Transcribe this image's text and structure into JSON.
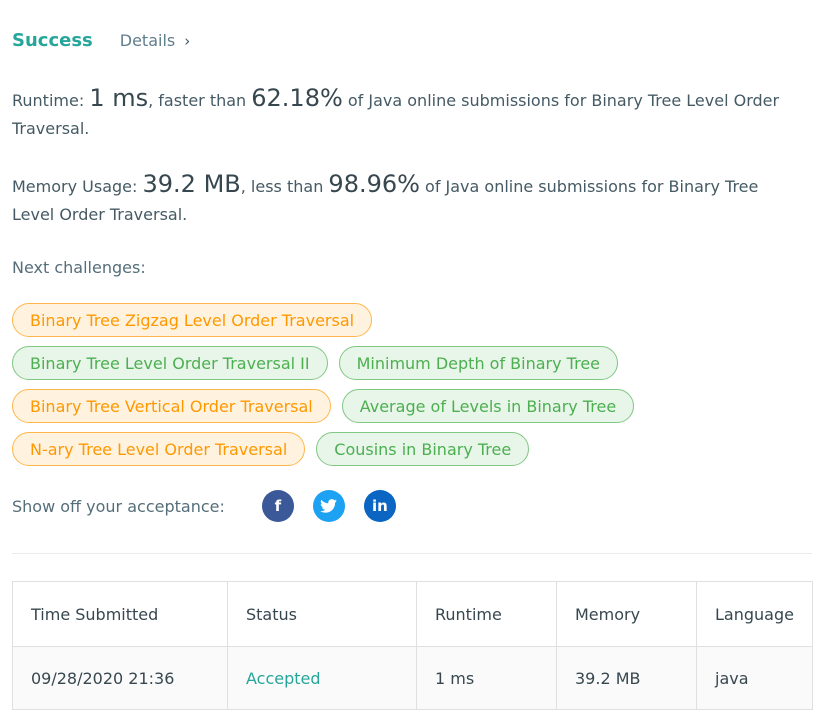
{
  "header": {
    "status": "Success",
    "details_label": "Details"
  },
  "runtime": {
    "label": "Runtime:",
    "value": "1 ms",
    "comparator": ", faster than ",
    "percent": "62.18%",
    "suffix": " of Java online submissions for Binary Tree Level Order Traversal."
  },
  "memory": {
    "label": "Memory Usage:",
    "value": "39.2 MB",
    "comparator": ", less than ",
    "percent": "98.96%",
    "suffix": " of Java online submissions for Binary Tree Level Order Traversal."
  },
  "next": {
    "label": "Next challenges:",
    "challenges": [
      {
        "title": "Binary Tree Zigzag Level Order Traversal",
        "difficulty": "medium"
      },
      {
        "title": "Binary Tree Level Order Traversal II",
        "difficulty": "easy"
      },
      {
        "title": "Minimum Depth of Binary Tree",
        "difficulty": "easy"
      },
      {
        "title": "Binary Tree Vertical Order Traversal",
        "difficulty": "medium"
      },
      {
        "title": "Average of Levels in Binary Tree",
        "difficulty": "easy"
      },
      {
        "title": "N-ary Tree Level Order Traversal",
        "difficulty": "medium"
      },
      {
        "title": "Cousins in Binary Tree",
        "difficulty": "easy"
      }
    ]
  },
  "share": {
    "label": "Show off your acceptance:",
    "icons": [
      "facebook-icon",
      "twitter-icon",
      "linkedin-icon"
    ]
  },
  "table": {
    "headers": [
      "Time Submitted",
      "Status",
      "Runtime",
      "Memory",
      "Language"
    ],
    "row": [
      "09/28/2020 21:36",
      "Accepted",
      "1 ms",
      "39.2 MB",
      "java"
    ]
  },
  "colors": {
    "success": "#26a69a",
    "medium": "#ff9800",
    "easy": "#4caf50",
    "facebook": "#3b5998",
    "twitter": "#1da1f2",
    "linkedin": "#0a66c2"
  }
}
